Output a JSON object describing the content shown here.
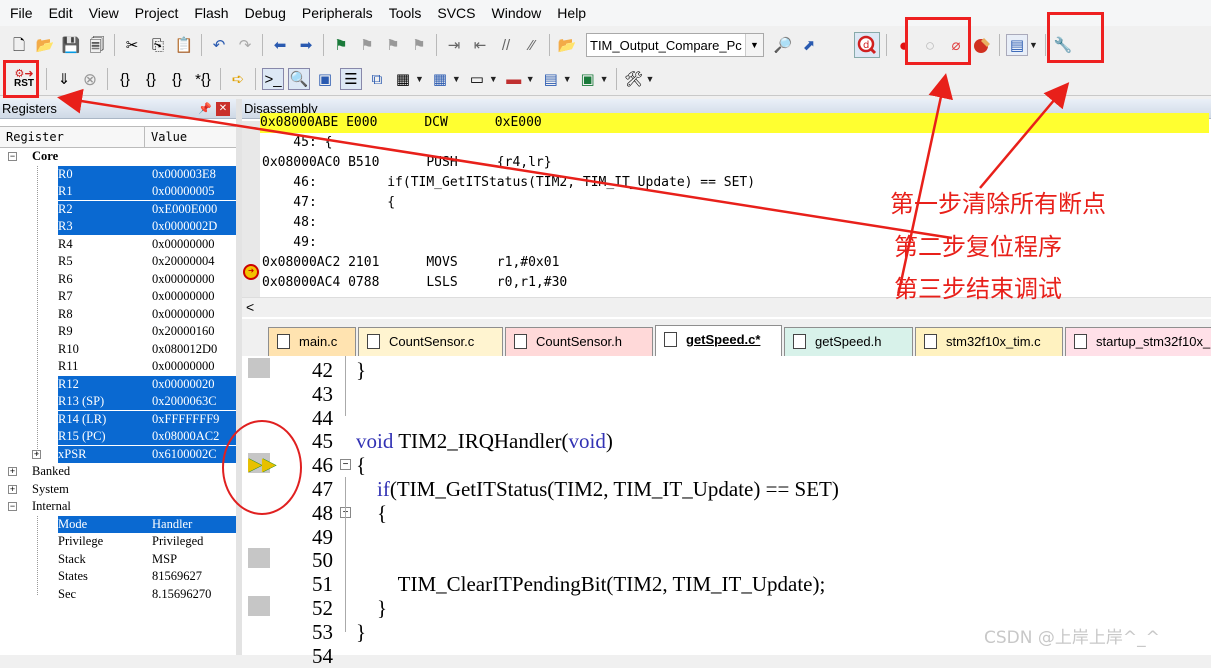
{
  "menu": [
    "File",
    "Edit",
    "View",
    "Project",
    "Flash",
    "Debug",
    "Peripherals",
    "Tools",
    "SVCS",
    "Window",
    "Help"
  ],
  "toolbar": {
    "target_combo": "TIM_Output_Compare_Pc",
    "rst_label": "RST"
  },
  "registers": {
    "title": "Registers",
    "col_register": "Register",
    "col_value": "Value",
    "core_label": "Core",
    "core_rows": [
      {
        "name": "R0",
        "value": "0x000003E8",
        "selected": true
      },
      {
        "name": "R1",
        "value": "0x00000005",
        "selected": true
      },
      {
        "name": "R2",
        "value": "0xE000E000",
        "selected": true
      },
      {
        "name": "R3",
        "value": "0x0000002D",
        "selected": true
      },
      {
        "name": "R4",
        "value": "0x00000000",
        "selected": false
      },
      {
        "name": "R5",
        "value": "0x20000004",
        "selected": false
      },
      {
        "name": "R6",
        "value": "0x00000000",
        "selected": false
      },
      {
        "name": "R7",
        "value": "0x00000000",
        "selected": false
      },
      {
        "name": "R8",
        "value": "0x00000000",
        "selected": false
      },
      {
        "name": "R9",
        "value": "0x20000160",
        "selected": false
      },
      {
        "name": "R10",
        "value": "0x080012D0",
        "selected": false
      },
      {
        "name": "R11",
        "value": "0x00000000",
        "selected": false
      },
      {
        "name": "R12",
        "value": "0x00000020",
        "selected": true
      },
      {
        "name": "R13 (SP)",
        "value": "0x2000063C",
        "selected": true
      },
      {
        "name": "R14 (LR)",
        "value": "0xFFFFFFF9",
        "selected": true
      },
      {
        "name": "R15 (PC)",
        "value": "0x08000AC2",
        "selected": true
      },
      {
        "name": "xPSR",
        "value": "0x6100002C",
        "selected": true
      }
    ],
    "banked_label": "Banked",
    "system_label": "System",
    "internal_label": "Internal",
    "internal_rows": [
      {
        "name": "Mode",
        "value": "Handler",
        "selected": true
      },
      {
        "name": "Privilege",
        "value": "Privileged",
        "selected": false
      },
      {
        "name": "Stack",
        "value": "MSP",
        "selected": false
      },
      {
        "name": "States",
        "value": "81569627",
        "selected": false
      },
      {
        "name": "Sec",
        "value": "8.15696270",
        "selected": false
      }
    ]
  },
  "disassembly": {
    "title": "Disassembly",
    "lines": [
      "0x08000ABE E000      DCW      0xE000",
      "    45: {",
      "0x08000AC0 B510      PUSH     {r4,lr}",
      "    46:         if(TIM_GetITStatus(TIM2, TIM_IT_Update) == SET)",
      "    47:         {",
      "    48:",
      "    49:",
      "0x08000AC2 2101      MOVS     r1,#0x01",
      "0x08000AC4 0788      LSLS     r0,r1,#30"
    ],
    "hscroll_arrow": "<"
  },
  "tabs": [
    "main.c",
    "CountSensor.c",
    "CountSensor.h",
    "getSpeed.c*",
    "getSpeed.h",
    "stm32f10x_tim.c",
    "startup_stm32f10x_md.s"
  ],
  "editor": {
    "line_numbers": [
      "42",
      "43",
      "44",
      "45",
      "46",
      "47",
      "48",
      "49",
      "50",
      "51",
      "52",
      "53",
      "54"
    ],
    "code_lines": [
      "}",
      "",
      "",
      "void TIM2_IRQHandler(void)",
      "{",
      "    if(TIM_GetITStatus(TIM2, TIM_IT_Update) == SET)",
      "    {",
      "",
      "",
      "        TIM_ClearITPendingBit(TIM2, TIM_IT_Update);",
      "    }",
      "}",
      ""
    ]
  },
  "annotations": {
    "step1": "第一步清除所有断点",
    "step2": "第二步复位程序",
    "step3": "第三步结束调试"
  },
  "watermark": "CSDN @上岸上岸^_^",
  "colors": {
    "selection": "#0a69d1",
    "current_line": "#ffff30",
    "annotation": "#e8201a",
    "keyword": "#3232b4"
  }
}
